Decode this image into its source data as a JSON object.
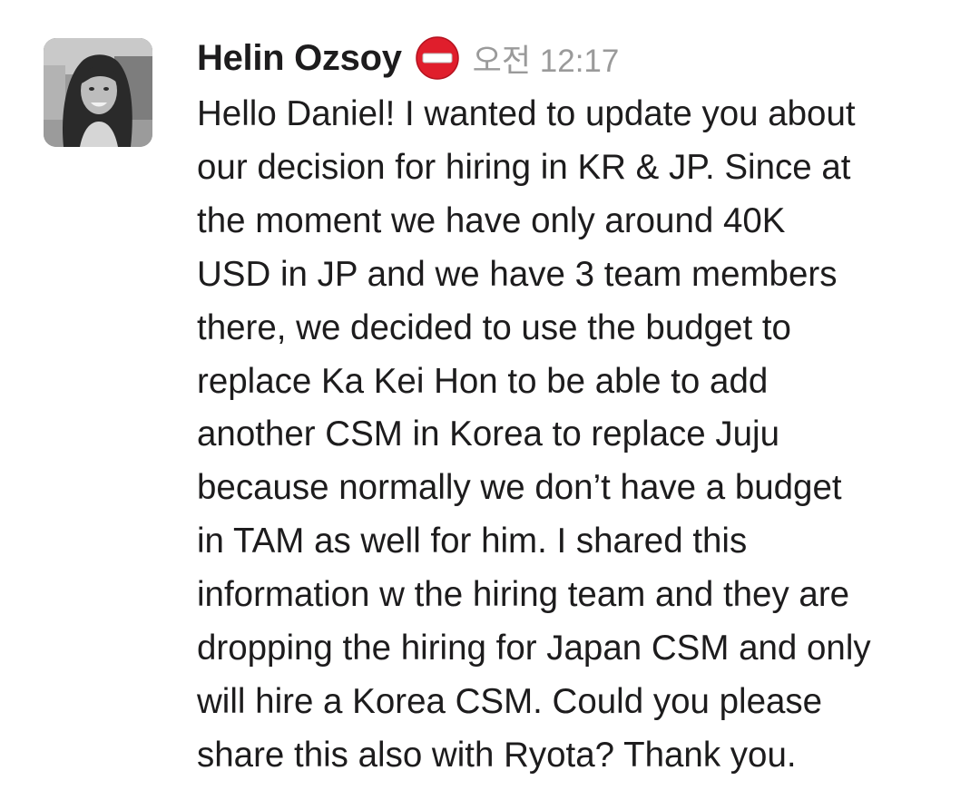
{
  "message": {
    "sender": {
      "name": "Helin Ozsoy",
      "status_icon": "no-entry-icon",
      "avatar": "profile-photo"
    },
    "timestamp": "오전 12:17",
    "lines": [
      "Hello Daniel! I wanted to update you about",
      "our decision for hiring in KR & JP. Since at",
      "the moment we have only around 40K",
      "USD in JP and we have 3 team members",
      "there, we decided to use the budget to",
      "replace Ka Kei Hon to be able to add",
      "another CSM in Korea to replace Juju",
      "because normally we don’t have a budget",
      "in TAM as well for him. I shared this",
      "information w the hiring team and they are",
      "dropping the hiring for Japan CSM and only",
      "will hire a Korea CSM. Could you please",
      "share this also with Ryota? Thank you."
    ]
  },
  "colors": {
    "text": "#1d1c1d",
    "timestamp": "#9a9a9a",
    "status_red": "#e01e2c",
    "background": "#ffffff"
  }
}
